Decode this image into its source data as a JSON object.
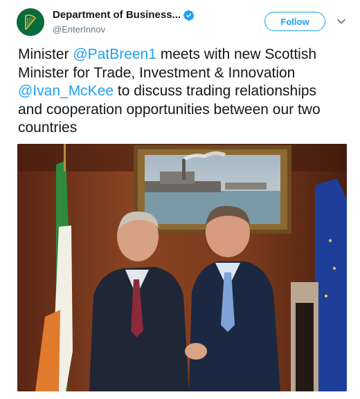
{
  "account": {
    "display_name": "Department of Business...",
    "handle": "@EnterInnov",
    "verified": true
  },
  "actions": {
    "follow_label": "Follow"
  },
  "tweet": {
    "text_parts": [
      {
        "type": "text",
        "value": "Minister "
      },
      {
        "type": "mention",
        "value": "@PatBreen1"
      },
      {
        "type": "text",
        "value": " meets with new Scottish Minister for Trade, Investment & Innovation "
      },
      {
        "type": "mention",
        "value": "@Ivan_McKee"
      },
      {
        "type": "text",
        "value": " to discuss trading relationships and cooperation opportunities between our two countries"
      }
    ]
  },
  "colors": {
    "link": "#1da1f2",
    "text": "#14171a",
    "secondary": "#657786",
    "avatar_bg": "#0a6b3d"
  },
  "icons": {
    "verified": "verified-badge-icon",
    "chevron": "chevron-down-icon",
    "avatar": "harp-logo-icon"
  }
}
